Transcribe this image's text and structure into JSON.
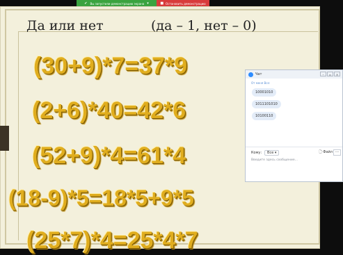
{
  "share_bar": {
    "status": "Вы запустили демонстрацию экрана",
    "stop_label": "Остановить демонстрацию"
  },
  "slide": {
    "title": "Да или нет",
    "hint": "(да – 1, нет – 0)",
    "equations": [
      "(30+9)*7=37*9",
      "(2+6)*40=42*6",
      "(52+9)*4=61*4",
      "(18-9)*5=18*5+9*5",
      "(25*7)*4=25*4*7"
    ]
  },
  "chat": {
    "title": "Чат",
    "from_line": "От меня Все:",
    "messages": [
      "10001010",
      "1011101010",
      "10100110"
    ],
    "to_label": "Кому:",
    "to_value": "Все",
    "file_label": "Файл",
    "input_placeholder": "Введите здесь сообщение..."
  },
  "colors": {
    "equation": "#e0ad1e",
    "share_green": "#3aa33f",
    "stop_red": "#d83b3b"
  }
}
